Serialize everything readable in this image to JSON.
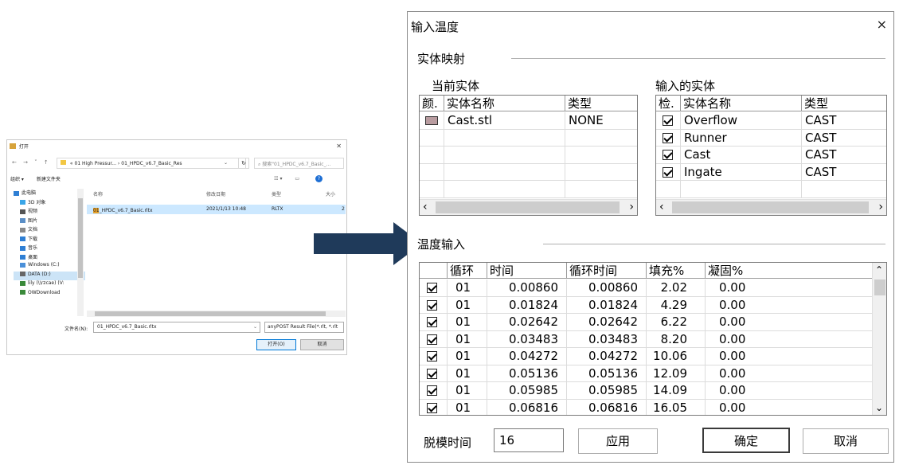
{
  "file_dialog": {
    "title": "打开",
    "path": {
      "prefix": "«",
      "segments": [
        "01 High Pressur...",
        "›",
        "01_HPDC_v6.7_Basic_Res"
      ]
    },
    "search_placeholder": "搜索\"01_HPDC_v6.7_Basic_...",
    "toolbar": {
      "organize": "组织 ▾",
      "new_folder": "新建文件夹"
    },
    "tree": [
      {
        "label": "此电脑",
        "icon": "pc-icon",
        "color": "#2f7fd4"
      },
      {
        "label": "3D 对象",
        "icon": "cube-icon",
        "color": "#3aa6e8"
      },
      {
        "label": "视频",
        "icon": "video-icon",
        "color": "#555555"
      },
      {
        "label": "图片",
        "icon": "image-icon",
        "color": "#5b8fc7"
      },
      {
        "label": "文档",
        "icon": "document-icon",
        "color": "#8a8a8a"
      },
      {
        "label": "下载",
        "icon": "download-icon",
        "color": "#2f7fd4"
      },
      {
        "label": "音乐",
        "icon": "music-icon",
        "color": "#2f7fd4"
      },
      {
        "label": "桌面",
        "icon": "desktop-icon",
        "color": "#2f7fd4"
      },
      {
        "label": "Windows (C:)",
        "icon": "drive-icon",
        "color": "#4a90d9"
      },
      {
        "label": "DATA (D:)",
        "icon": "drive-icon",
        "color": "#666666",
        "selected": true
      },
      {
        "label": "lily (\\\\rzcae) (V:",
        "icon": "network-drive-icon",
        "color": "#3a8a3a"
      },
      {
        "label": "OWDownload",
        "icon": "network-drive-icon",
        "color": "#3a8a3a"
      }
    ],
    "columns": [
      "名称",
      "修改日期",
      "类型",
      "大小"
    ],
    "files": [
      {
        "name": "01_HPDC_v6.7_Basic.rltx",
        "modified": "2021/1/13 10:48",
        "type": "RLTX",
        "size": "2"
      }
    ],
    "filename_label": "文件名(N):",
    "filename_value": "01_HPDC_v6.7_Basic.rltx",
    "filetype_value": "anyPOST Result File(*.rlt, *.rlt",
    "open_button": "打开(O)",
    "cancel_button": "取消"
  },
  "dialog": {
    "title": "输入温度",
    "close_glyph": "×",
    "entity_mapping_label": "实体映射",
    "current_entity_label": "当前实体",
    "imported_entity_label": "输入的实体",
    "current_columns": [
      "颜.",
      "实体名称",
      "类型"
    ],
    "current_rows": [
      {
        "color": "#b99ca0",
        "name": "Cast.stl",
        "type": "NONE"
      }
    ],
    "imported_columns": [
      "检.",
      "实体名称",
      "类型"
    ],
    "imported_rows": [
      {
        "checked": true,
        "name": "Overflow",
        "type": "CAST"
      },
      {
        "checked": true,
        "name": "Runner",
        "type": "CAST"
      },
      {
        "checked": true,
        "name": "Cast",
        "type": "CAST"
      },
      {
        "checked": true,
        "name": "Ingate",
        "type": "CAST"
      }
    ],
    "temperature_input_label": "温度输入",
    "temp_columns": [
      "",
      "循环",
      "时间",
      "循环时间",
      "填充%",
      "凝固%"
    ],
    "temp_rows": [
      {
        "checked": true,
        "cycle": "01",
        "time": "0.00860",
        "cycle_time": "0.00860",
        "fill": "2.02",
        "solid": "0.00"
      },
      {
        "checked": true,
        "cycle": "01",
        "time": "0.01824",
        "cycle_time": "0.01824",
        "fill": "4.29",
        "solid": "0.00"
      },
      {
        "checked": true,
        "cycle": "01",
        "time": "0.02642",
        "cycle_time": "0.02642",
        "fill": "6.22",
        "solid": "0.00"
      },
      {
        "checked": true,
        "cycle": "01",
        "time": "0.03483",
        "cycle_time": "0.03483",
        "fill": "8.20",
        "solid": "0.00"
      },
      {
        "checked": true,
        "cycle": "01",
        "time": "0.04272",
        "cycle_time": "0.04272",
        "fill": "10.06",
        "solid": "0.00"
      },
      {
        "checked": true,
        "cycle": "01",
        "time": "0.05136",
        "cycle_time": "0.05136",
        "fill": "12.09",
        "solid": "0.00"
      },
      {
        "checked": true,
        "cycle": "01",
        "time": "0.05985",
        "cycle_time": "0.05985",
        "fill": "14.09",
        "solid": "0.00"
      },
      {
        "checked": true,
        "cycle": "01",
        "time": "0.06816",
        "cycle_time": "0.06816",
        "fill": "16.05",
        "solid": "0.00"
      }
    ],
    "demold_label": "脱模时间",
    "demold_value": "16",
    "apply_button": "应用",
    "ok_button": "确定",
    "cancel_button": "取消"
  },
  "colors": {
    "arrow": "#1f3a5a",
    "selection": "#cce8ff"
  }
}
